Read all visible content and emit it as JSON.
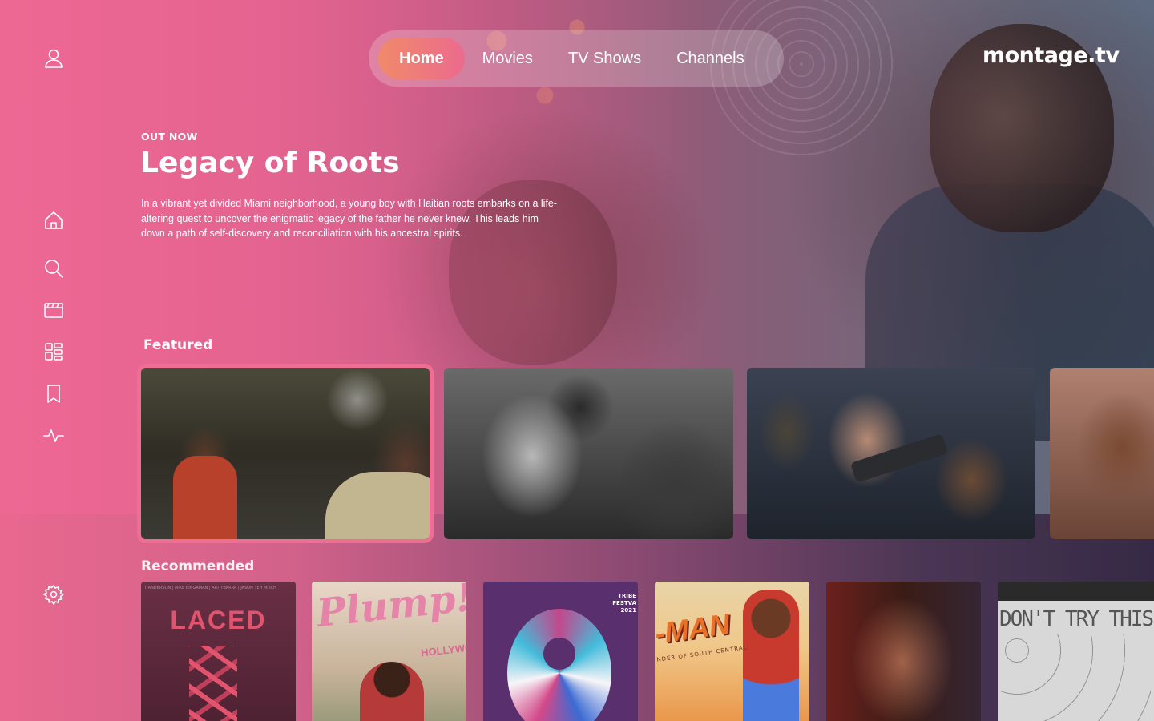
{
  "app": {
    "logo": "montage.tv"
  },
  "nav": {
    "tabs": [
      {
        "label": "Home",
        "active": true
      },
      {
        "label": "Movies",
        "active": false
      },
      {
        "label": "TV Shows",
        "active": false
      },
      {
        "label": "Channels",
        "active": false
      }
    ]
  },
  "sidebar": {
    "items": [
      {
        "icon": "user-icon"
      },
      {
        "icon": "home-icon"
      },
      {
        "icon": "search-icon"
      },
      {
        "icon": "clapperboard-icon"
      },
      {
        "icon": "grid-icon"
      },
      {
        "icon": "bookmark-icon"
      },
      {
        "icon": "activity-icon"
      },
      {
        "icon": "settings-icon"
      }
    ]
  },
  "hero": {
    "eyebrow": "OUT NOW",
    "title": "Legacy of Roots",
    "description": "In a vibrant yet divided Miami neighborhood, a young boy with Haitian roots embarks on a life-altering quest to uncover the enigmatic legacy of the father he never knew. This leads him down a path of self-discovery and reconciliation with his ancestral spirits."
  },
  "featured": {
    "label": "Featured",
    "selected_index": 0,
    "count": 4
  },
  "recommended": {
    "label": "Recommended",
    "posters": [
      {
        "title": "LACED",
        "credits": "T ANDERSON | MIKE BINGAMAN | ART YBARRA | JASON TEH MITCH"
      },
      {
        "title": "Plump!",
        "subtitle": "HOLLYWO"
      },
      {
        "festival": "TRIBE\nFESTVA\n2021"
      },
      {
        "title": "-MAN",
        "subtitle": "NDER OF SOUTH CENTRAL"
      },
      {},
      {
        "title": "DON'T TRY THIS ALON"
      }
    ]
  },
  "colors": {
    "accent": "#ec6a8e",
    "accent_gradient_start": "#f08a6a",
    "pink_base": "#e8658f"
  }
}
